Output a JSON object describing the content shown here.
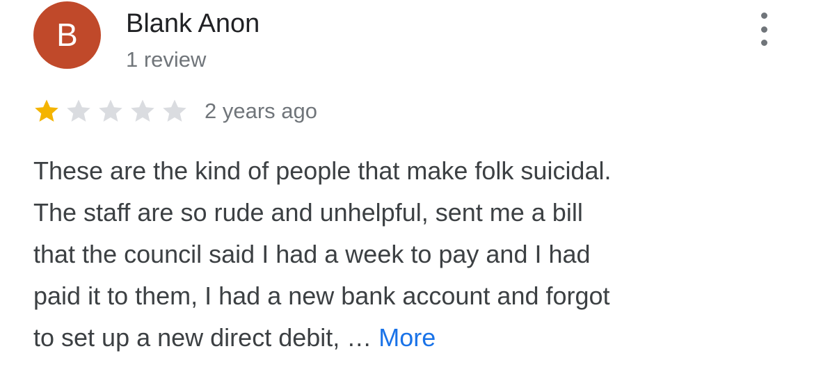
{
  "reviewer": {
    "initial": "B",
    "name": "Blank Anon",
    "review_count": "1 review",
    "avatar_color": "#c0492a"
  },
  "rating": {
    "stars": 1,
    "max_stars": 5,
    "filled_color": "#f4b400",
    "empty_color": "#dadce0",
    "time": "2 years ago"
  },
  "review": {
    "lines": [
      "These are the kind of people that make folk suicidal.",
      "The staff are so rude and unhelpful, sent me a bill",
      "that the council said I had a week to pay and I had",
      "paid it to them, I had a new bank account and forgot",
      "to set up a new direct debit, … "
    ],
    "more_label": "More"
  },
  "menu": {
    "icon": "more-vert-icon"
  }
}
